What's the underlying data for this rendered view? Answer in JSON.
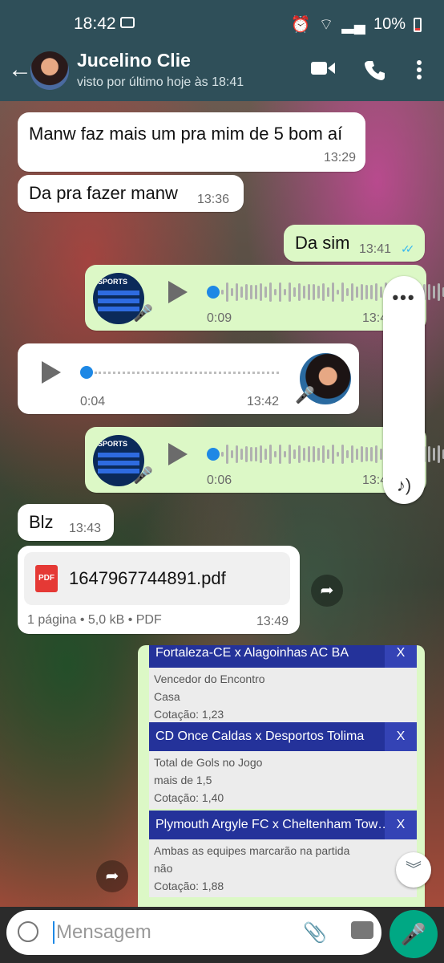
{
  "status": {
    "time": "18:42",
    "battery": "10%"
  },
  "header": {
    "name": "Jucelino Clie",
    "last_seen": "visto por último hoje às 18:41"
  },
  "messages": {
    "m1": {
      "text": "Manw faz mais um pra mim de 5 bom aí",
      "time": "13:29"
    },
    "m2": {
      "text": "Da pra fazer manw",
      "time": "13:36"
    },
    "m3": {
      "text": "Da sim",
      "time": "13:41"
    },
    "a1": {
      "duration": "0:09",
      "time": "13:4"
    },
    "a2": {
      "duration": "0:04",
      "time": "13:42"
    },
    "a3": {
      "duration": "0:06",
      "time": "13:4"
    },
    "m4": {
      "text": "Blz",
      "time": "13:43"
    },
    "pdf": {
      "filename": "1647967744891.pdf",
      "icon_label": "PDF",
      "meta": "1 página • 5,0 kB • PDF",
      "time": "13:49"
    }
  },
  "bet_card": {
    "rows": [
      {
        "team": "Fortaleza-CE x Alagoinhas AC BA",
        "market": "Vencedor do Encontro",
        "pick": "Casa",
        "odds": "Cotação: 1,23"
      },
      {
        "team": "CD Once Caldas x Desportos Tolima",
        "market": "Total de Gols no Jogo",
        "pick": "mais de 1,5",
        "odds": "Cotação: 1,40"
      },
      {
        "team": "Plymouth Argyle FC x Cheltenham Tow…",
        "market": "Ambas as equipes marcarão na partida",
        "pick": "não",
        "odds": "Cotação: 1,88"
      }
    ],
    "remove_label": "X"
  },
  "thumb_text": "SPORTS",
  "input": {
    "placeholder": "Mensagem"
  },
  "icons": {
    "back": "arrow-left-icon",
    "video": "video-call-icon",
    "phone": "phone-icon",
    "menu": "more-vert-icon",
    "mic": "mic-icon",
    "emoji": "emoji-icon",
    "attach": "paperclip-icon",
    "camera": "camera-icon",
    "forward": "forward-icon",
    "scroll": "chevron-double-down-icon"
  },
  "colors": {
    "header": "#2f4f59",
    "outgoing": "#dcf8c6",
    "incoming": "#ffffff",
    "accent": "#00a884",
    "bet_header": "#24329a"
  }
}
